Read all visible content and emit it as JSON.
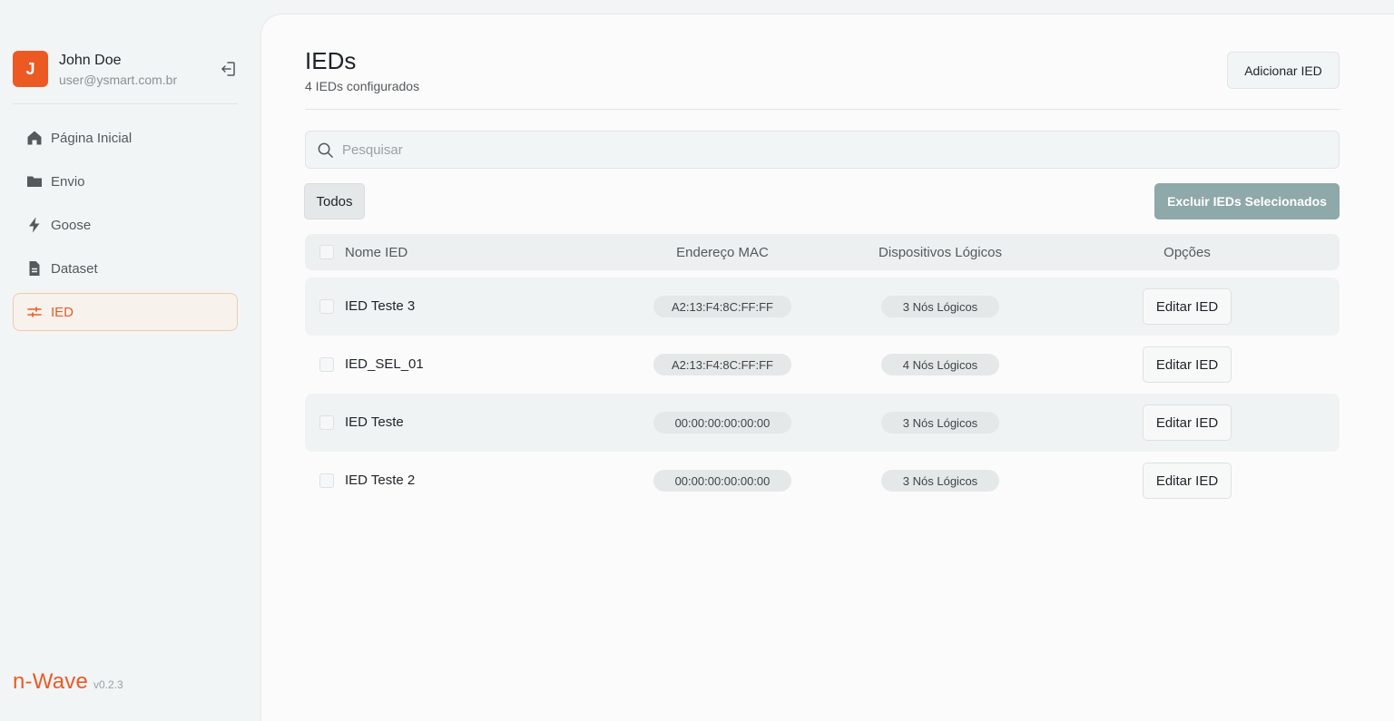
{
  "user": {
    "initial": "J",
    "name": "John Doe",
    "email": "user@ysmart.com.br"
  },
  "nav": {
    "items": [
      {
        "label": "Página Inicial",
        "icon": "home-icon"
      },
      {
        "label": "Envio",
        "icon": "folder-icon"
      },
      {
        "label": "Goose",
        "icon": "lightning-icon"
      },
      {
        "label": "Dataset",
        "icon": "document-icon"
      },
      {
        "label": "IED",
        "icon": "sliders-icon",
        "active": true
      }
    ]
  },
  "brand": {
    "name": "n-Wave",
    "version": "v0.2.3"
  },
  "header": {
    "title": "IEDs",
    "subtitle": "4 IEDs configurados",
    "add_button": "Adicionar IED"
  },
  "search": {
    "placeholder": "Pesquisar",
    "value": ""
  },
  "filters": {
    "all_label": "Todos",
    "delete_selected_label": "Excluir IEDs Selecionados"
  },
  "table": {
    "columns": [
      "Nome IED",
      "Endereço MAC",
      "Dispositivos Lógicos",
      "Opções"
    ],
    "rows": [
      {
        "name": "IED Teste 3",
        "mac": "A2:13:F4:8C:FF:FF",
        "logical": "3 Nós Lógicos",
        "action": "Editar IED"
      },
      {
        "name": "IED_SEL_01",
        "mac": "A2:13:F4:8C:FF:FF",
        "logical": "4 Nós Lógicos",
        "action": "Editar IED"
      },
      {
        "name": "IED Teste",
        "mac": "00:00:00:00:00:00",
        "logical": "3 Nós Lógicos",
        "action": "Editar IED"
      },
      {
        "name": "IED Teste 2",
        "mac": "00:00:00:00:00:00",
        "logical": "3 Nós Lógicos",
        "action": "Editar IED"
      }
    ]
  },
  "colors": {
    "accent": "#ec5a24",
    "delete_button": "#8fa8aa",
    "active_nav_bg": "#f7f2ec"
  }
}
